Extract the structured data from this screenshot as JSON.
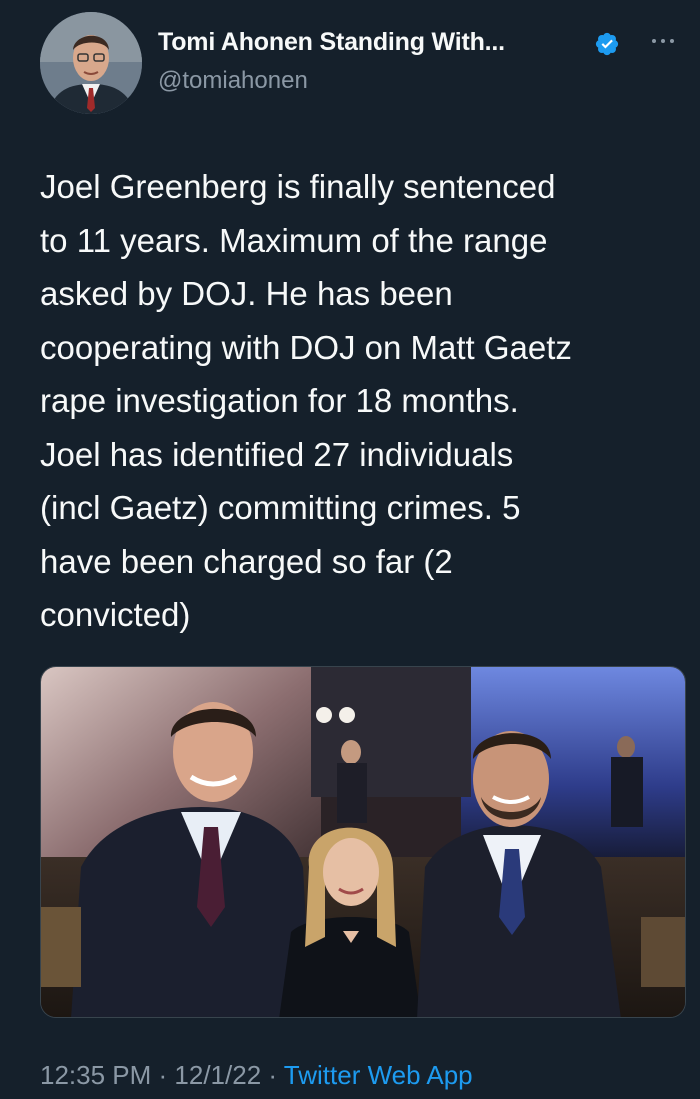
{
  "author": {
    "display_name": "Tomi Ahonen Standing With...",
    "handle": "@tomiahonen",
    "verified": true,
    "avatar_icon": "profile-photo"
  },
  "tweet": {
    "text_lines": [
      "Joel Greenberg is finally sentenced",
      "to 11 years. Maximum of the range",
      "asked by DOJ. He has been",
      "cooperating with DOJ on Matt Gaetz",
      "rape investigation for 18 months.",
      "Joel has identified 27 individuals",
      "(incl Gaetz) committing crimes. 5",
      "have been charged so far (2",
      "convicted)"
    ]
  },
  "meta": {
    "time": "12:35 PM",
    "sep1": " · ",
    "date": "12/1/22",
    "sep2": " · ",
    "source": "Twitter Web App"
  },
  "colors": {
    "background": "#15202b",
    "text": "#f7f9f9",
    "secondary": "#8b98a5",
    "accent": "#1d9bf0"
  },
  "icons": {
    "verified": "verified-badge-icon",
    "more": "more-dots-icon"
  }
}
